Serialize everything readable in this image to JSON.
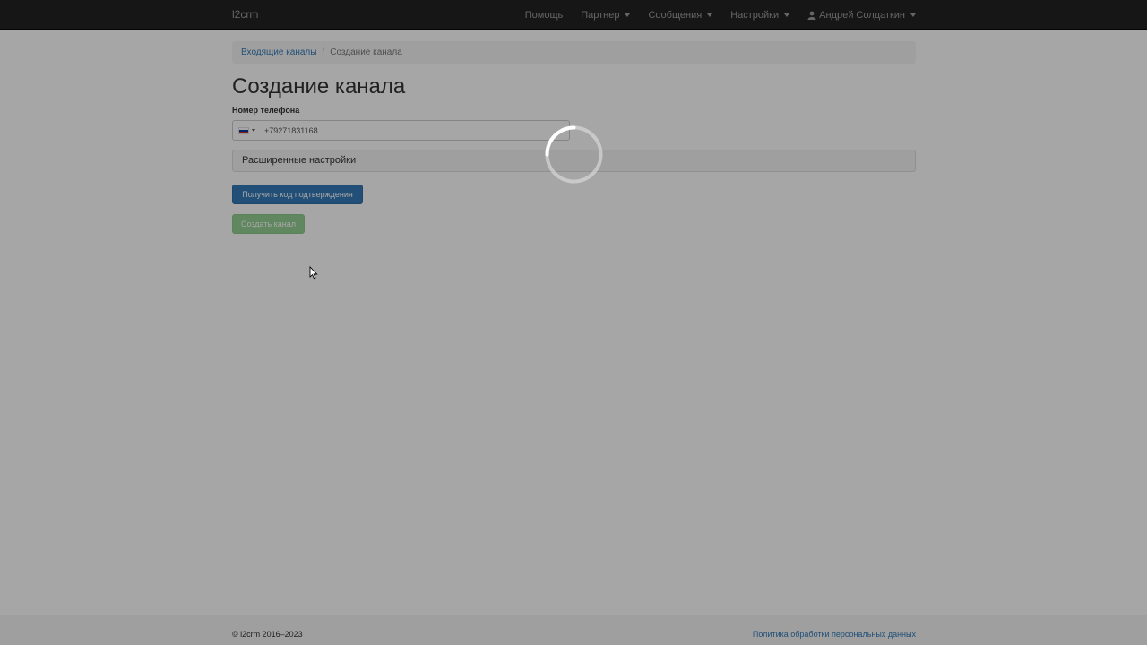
{
  "navbar": {
    "brand": "l2crm",
    "items": [
      {
        "label": "Помощь",
        "dropdown": false
      },
      {
        "label": "Партнер",
        "dropdown": true
      },
      {
        "label": "Сообщения",
        "dropdown": true
      },
      {
        "label": "Настройки",
        "dropdown": true
      }
    ],
    "user": {
      "label": "Андрей Солдаткин",
      "icon": "user-icon"
    }
  },
  "breadcrumb": {
    "parent": "Входящие каналы",
    "current": "Создание канала"
  },
  "page": {
    "title": "Создание канала",
    "phone_label": "Номер телефона",
    "phone_value": "+79271831168",
    "country_flag": "ru",
    "advanced_settings": "Расширенные настройки",
    "get_code_button": "Получить код подтверждения",
    "create_button": "Создать канал"
  },
  "footer": {
    "copyright": "© l2crm 2016–2023",
    "policy_link": "Политика обработки персональных данных"
  },
  "colors": {
    "navbar": "#222222",
    "primary": "#337ab7",
    "success": "#5cb85c"
  }
}
